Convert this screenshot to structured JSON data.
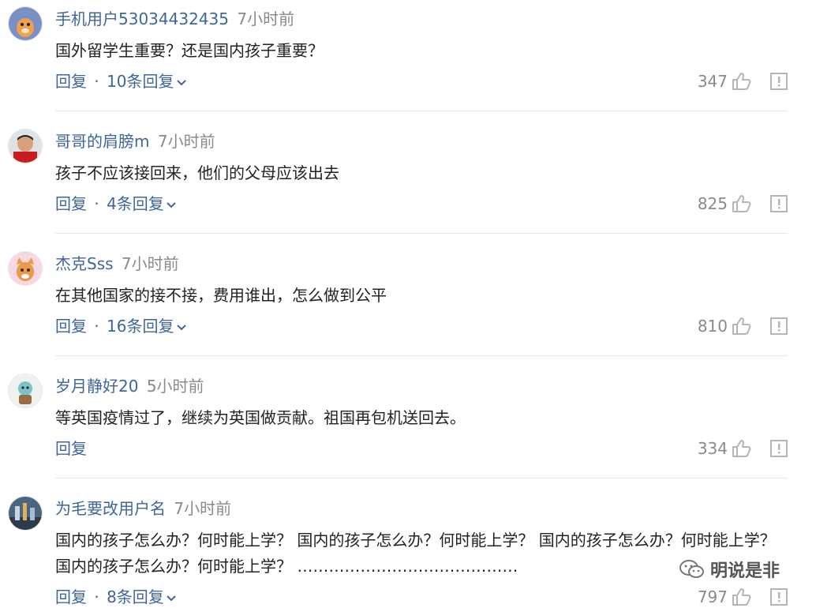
{
  "comments": [
    {
      "user": "手机用户53034432435",
      "time": "7小时前",
      "text": "国外留学生重要？还是国内孩子重要？",
      "reply": "回复",
      "sep": "·",
      "replies": "10条回复",
      "likes": "347"
    },
    {
      "user": "哥哥的肩膀m",
      "time": "7小时前",
      "text": "孩子不应该接回来，他们的父母应该出去",
      "reply": "回复",
      "sep": "·",
      "replies": "4条回复",
      "likes": "825"
    },
    {
      "user": "杰克Sss",
      "time": "7小时前",
      "text": "在其他国家的接不接，费用谁出，怎么做到公平",
      "reply": "回复",
      "sep": "·",
      "replies": "16条回复",
      "likes": "810"
    },
    {
      "user": "岁月静好20",
      "time": "5小时前",
      "text": "等英国疫情过了，继续为英国做贡献。祖国再包机送回去。",
      "reply": "回复",
      "likes": "334"
    },
    {
      "user": "为毛要改用户名",
      "time": "7小时前",
      "text": "国内的孩子怎么办？何时能上学？ 国内的孩子怎么办？何时能上学？ 国内的孩子怎么办？何时能上学？ 国内的孩子怎么办？何时能上学？ ……………………………………",
      "reply": "回复",
      "sep": "·",
      "replies": "8条回复",
      "likes": "797"
    }
  ],
  "watermark": "明说是非",
  "colors": {
    "link": "#406599",
    "muted": "#8a8a8a",
    "text": "#222222",
    "divider": "#e8e8e8"
  }
}
